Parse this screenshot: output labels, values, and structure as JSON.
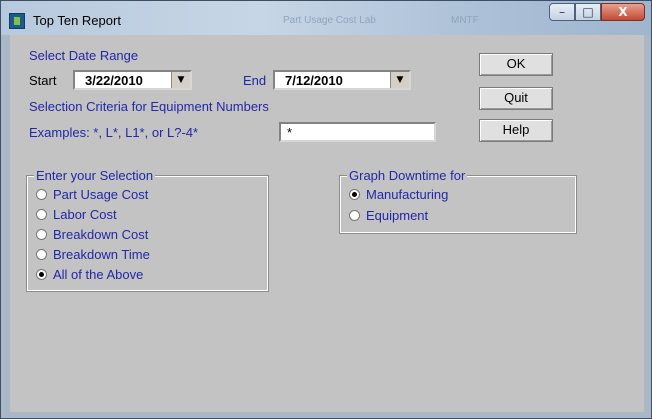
{
  "window": {
    "title": "Top Ten Report",
    "ghost_title_1": "Part Usage Cost Lab",
    "ghost_title_2": "MNTF",
    "minimize_label": "–",
    "maximize_label": "□",
    "close_label": "X"
  },
  "date_range": {
    "heading": "Select Date Range",
    "start_label": "Start",
    "start_value": "3/22/2010",
    "end_label": "End",
    "end_value": "7/12/2010",
    "dropdown_arrow": "▼"
  },
  "criteria": {
    "heading": "Selection Criteria for Equipment Numbers",
    "examples_label": "Examples: *, L*, L1*, or L?-4*",
    "value": "*"
  },
  "buttons": {
    "ok": "OK",
    "quit": "Quit",
    "help": "Help"
  },
  "selection_group": {
    "legend": "Enter your Selection",
    "options": [
      {
        "label": "Part Usage Cost",
        "selected": false
      },
      {
        "label": "Labor Cost",
        "selected": false
      },
      {
        "label": "Breakdown Cost",
        "selected": false
      },
      {
        "label": "Breakdown Time",
        "selected": false
      },
      {
        "label": "All of the Above",
        "selected": true
      }
    ]
  },
  "graph_group": {
    "legend": "Graph Downtime for",
    "options": [
      {
        "label": "Manufacturing",
        "selected": true
      },
      {
        "label": "Equipment",
        "selected": false
      }
    ]
  },
  "colors": {
    "label_text": "#2327a8",
    "client_bg": "#c3c3c3",
    "close_button": "#c24a35"
  }
}
